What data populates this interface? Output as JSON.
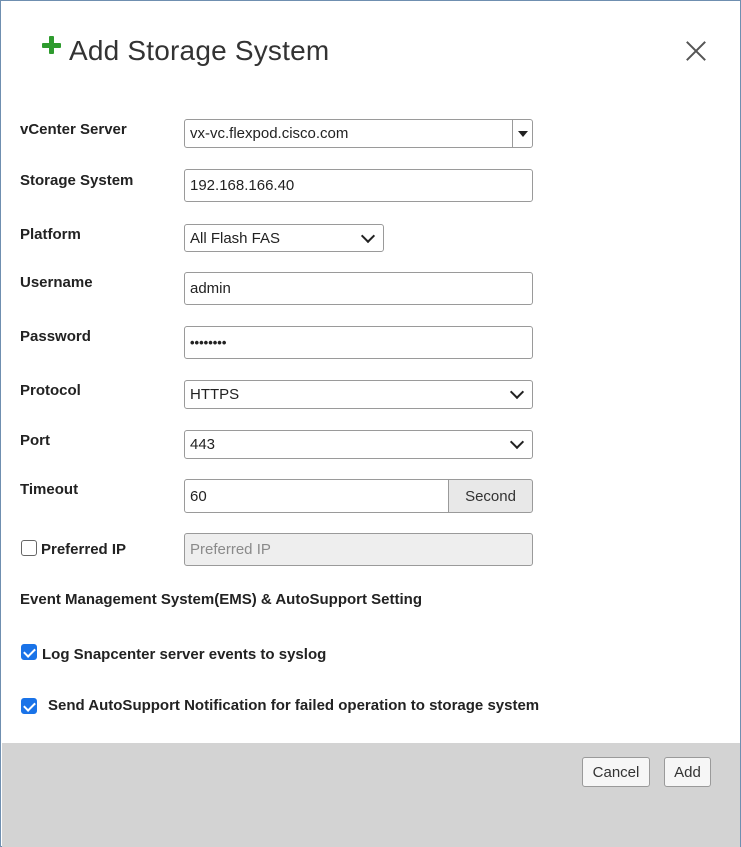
{
  "dialog": {
    "title": "Add Storage System"
  },
  "form": {
    "vcenter_label": "vCenter Server",
    "vcenter_value": "vx-vc.flexpod.cisco.com",
    "storage_label": "Storage System",
    "storage_value": "192.168.166.40",
    "platform_label": "Platform",
    "platform_value": "All Flash FAS",
    "username_label": "Username",
    "username_value": "admin",
    "password_label": "Password",
    "password_value": "••••••••",
    "protocol_label": "Protocol",
    "protocol_value": "HTTPS",
    "port_label": "Port",
    "port_value": "443",
    "timeout_label": "Timeout",
    "timeout_value": "60",
    "timeout_unit": "Second",
    "preferred_ip_label": "Preferred IP",
    "preferred_ip_checked": false,
    "preferred_ip_placeholder": "Preferred IP"
  },
  "ems": {
    "heading": "Event Management System(EMS) & AutoSupport Setting",
    "log_label": "Log Snapcenter server events to syslog",
    "log_checked": true,
    "autosupport_label": "Send AutoSupport Notification for failed operation to storage system",
    "autosupport_checked": true
  },
  "footer": {
    "cancel_label": "Cancel",
    "add_label": "Add"
  },
  "colors": {
    "accent": "#1a73e8",
    "plus": "#2e9b2e",
    "footer_bg": "#d3d3d3"
  }
}
